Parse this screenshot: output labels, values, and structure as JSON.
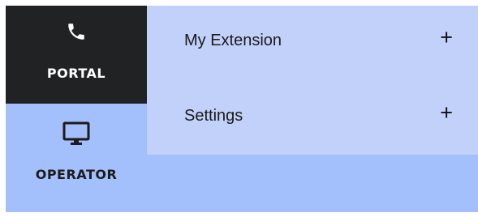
{
  "nav": {
    "items": [
      {
        "label": "PORTAL",
        "icon": "phone-icon",
        "active": true
      },
      {
        "label": "OPERATOR",
        "icon": "monitor-icon",
        "active": false
      }
    ]
  },
  "submenu": {
    "items": [
      {
        "label": "My Extension",
        "expand_symbol": "+"
      },
      {
        "label": "Settings",
        "expand_symbol": "+"
      }
    ]
  },
  "colors": {
    "nav_active_bg": "#212223",
    "nav_bg": "#a4c0fc",
    "submenu_bg": "#c2d1fa"
  }
}
